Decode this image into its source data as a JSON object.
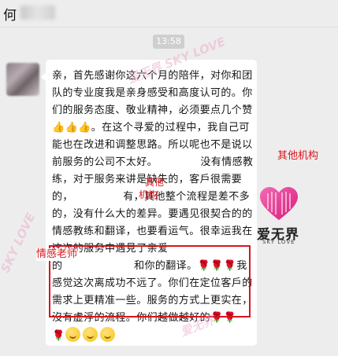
{
  "header": {
    "contact_name": "何"
  },
  "timestamp": "13:58",
  "message": {
    "p1": "亲，首先感谢你这六个月的陪伴，对你和团队的专业度我是亲身感受和高度认可的。你们的服务态度、敬业精神，必须要点几个赞",
    "p2": "。在这个寻爱的过程中，我自己可能也在改进和调整思路。所以呢也不是说以前服务的公司不太好。",
    "p3": "没有情感教练，对于服务来讲是缺失的，客戶很需要的，",
    "p4": "有，其他整个流程是差不多的，没有什么大的差异。要遇见很契合的的情感教练和翻译，也要看运气。很幸运我在这次的服务中遇見了亲爱的",
    "p5": "和你的翻译。",
    "p6": "我感觉这次离成功不远了。你们在定位客戶的需求上更精准一些。服务的方式上更实在，沒有虚浮的流程。你们越做越好的",
    "thumbs": [
      "👍",
      "👍",
      "👍"
    ],
    "roses_a": [
      "🌹",
      "🌹",
      "🌹"
    ],
    "roses_b": [
      "🌹",
      "🌹"
    ],
    "roses_c": [
      "🌹"
    ]
  },
  "annotations": {
    "other_agency_1": "其他机构",
    "other_agency_2a": "其他",
    "other_agency_2b": "机构",
    "emotion_teacher": "情感老师"
  },
  "watermarks": {
    "primary": "爱无界",
    "secondary": "SKY LOVE",
    "combined": "爱无界 SKY LOVE"
  },
  "logo": {
    "name": "爱无界",
    "sub": "SKY LOVE"
  },
  "colors": {
    "annotation": "#d8141c",
    "bubble": "#ffffff",
    "background": "#ededed",
    "watermark": "#e9a5c7"
  }
}
